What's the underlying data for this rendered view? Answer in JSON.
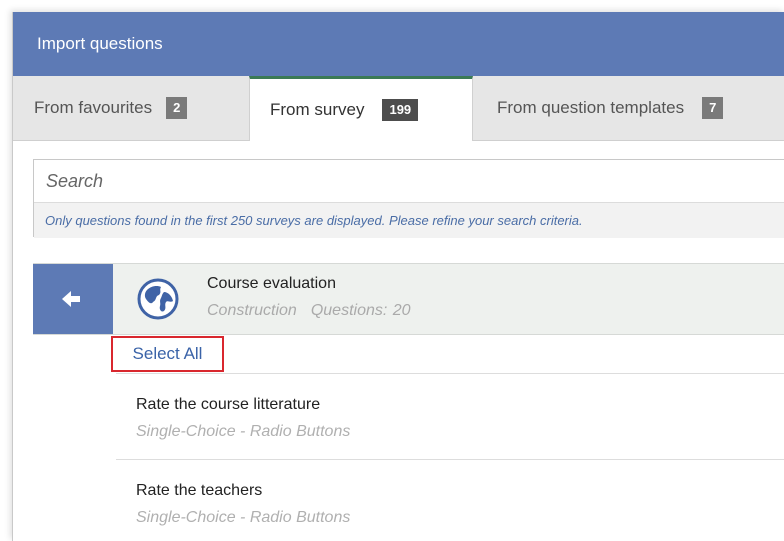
{
  "dialog": {
    "title": "Import questions"
  },
  "tabs": [
    {
      "label": "From favourites",
      "count": "2",
      "active": false
    },
    {
      "label": "From survey",
      "count": "199",
      "active": true
    },
    {
      "label": "From question templates",
      "count": "7",
      "active": false
    }
  ],
  "search": {
    "placeholder": "Search",
    "value": "",
    "hint": "Only questions found in the first 250 surveys are displayed. Please refine your search criteria."
  },
  "survey": {
    "back_icon": "arrow-left-icon",
    "icon": "globe-icon",
    "title": "Course evaluation",
    "category": "Construction",
    "questions": "Questions: 20"
  },
  "select_all": {
    "label": "Select All",
    "highlight_color": "#d9272e"
  },
  "questions": [
    {
      "title": "Rate the course litterature",
      "type": "Single-Choice - Radio Buttons"
    },
    {
      "title": "Rate the teachers",
      "type": "Single-Choice - Radio Buttons"
    }
  ],
  "colors": {
    "header": "#5d7ab5",
    "active_tab_border": "#3b7a55",
    "link": "#3a63a8"
  }
}
